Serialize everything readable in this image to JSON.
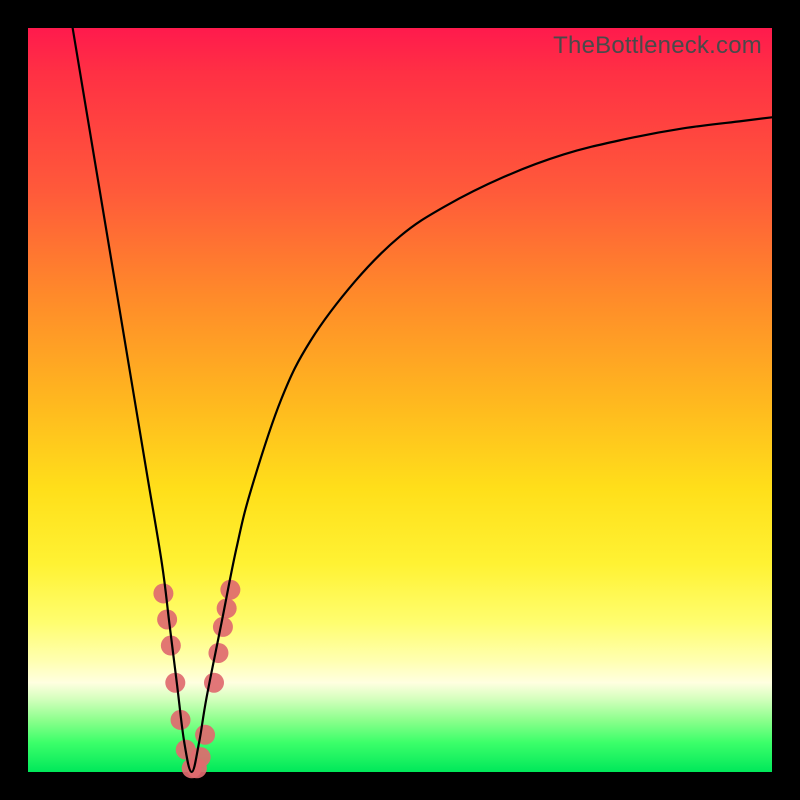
{
  "watermark": "TheBottleneck.com",
  "chart_data": {
    "type": "line",
    "title": "",
    "xlabel": "",
    "ylabel": "",
    "xlim": [
      0,
      100
    ],
    "ylim": [
      0,
      100
    ],
    "grid": false,
    "legend": false,
    "series": [
      {
        "name": "bottleneck-curve",
        "color": "#000000",
        "x": [
          6,
          8,
          10,
          12,
          14,
          16,
          18,
          19,
          20,
          21,
          22,
          23,
          24,
          26,
          28,
          30,
          34,
          38,
          44,
          50,
          56,
          64,
          72,
          80,
          88,
          96,
          100
        ],
        "y": [
          100,
          88,
          76,
          64,
          52,
          40,
          28,
          20,
          12,
          4,
          0,
          4,
          10,
          20,
          30,
          38,
          50,
          58,
          66,
          72,
          76,
          80,
          83,
          85,
          86.5,
          87.5,
          88
        ]
      }
    ],
    "markers": [
      {
        "name": "highlight-dots",
        "color": "#e06a6f",
        "radius_px": 10,
        "points": [
          {
            "x": 18.2,
            "y": 24
          },
          {
            "x": 18.7,
            "y": 20.5
          },
          {
            "x": 19.2,
            "y": 17
          },
          {
            "x": 19.8,
            "y": 12
          },
          {
            "x": 20.5,
            "y": 7
          },
          {
            "x": 21.2,
            "y": 3
          },
          {
            "x": 22.0,
            "y": 0.5
          },
          {
            "x": 22.7,
            "y": 0.5
          },
          {
            "x": 23.2,
            "y": 2
          },
          {
            "x": 23.8,
            "y": 5
          },
          {
            "x": 25.0,
            "y": 12
          },
          {
            "x": 25.6,
            "y": 16
          },
          {
            "x": 26.2,
            "y": 19.5
          },
          {
            "x": 26.7,
            "y": 22
          },
          {
            "x": 27.2,
            "y": 24.5
          }
        ]
      }
    ]
  }
}
